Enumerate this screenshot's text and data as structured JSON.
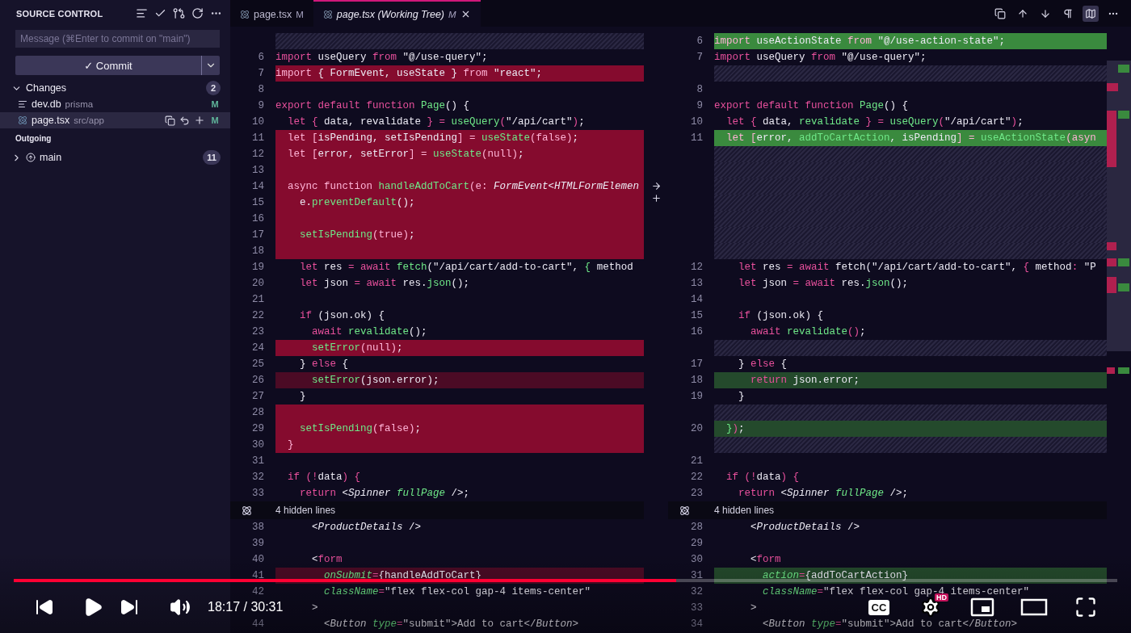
{
  "sidebar": {
    "title": "SOURCE CONTROL",
    "message": {
      "placeholder": "Message (⌘Enter to commit on \"main\")"
    },
    "commit": {
      "label": "✓ Commit"
    },
    "changes": {
      "label": "Changes",
      "count": "2",
      "expanded": true,
      "files": [
        {
          "name": "dev.db",
          "path": "prisma",
          "status": "M",
          "selected": false,
          "kind": "text"
        },
        {
          "name": "page.tsx",
          "path": "src/app",
          "status": "M",
          "selected": true,
          "kind": "react"
        }
      ]
    },
    "outgoing": {
      "label": "Outgoing",
      "branches": [
        {
          "name": "main",
          "count": "11",
          "expanded": false
        }
      ]
    }
  },
  "tabs": [
    {
      "name": "page.tsx",
      "status": "M",
      "italic": false,
      "selected": false
    },
    {
      "name": "page.tsx (Working Tree)",
      "status": "M",
      "italic": true,
      "selected": true
    }
  ],
  "diff": {
    "original": [
      {
        "kind": "filler"
      },
      {
        "kind": "line",
        "num": "6",
        "code": [
          {
            "text": "import ",
            "kind": "keyword"
          },
          {
            "text": "useQuery ",
            "kind": "plain"
          },
          {
            "text": "from ",
            "kind": "keyword"
          },
          {
            "text": "\"@/use-query\";",
            "kind": "plain"
          }
        ]
      },
      {
        "kind": "removed",
        "num": "7",
        "code": [
          {
            "text": "import ",
            "kind": "keyword"
          },
          {
            "text": "{ FormEvent, useState } ",
            "kind": "plain"
          },
          {
            "text": "from ",
            "kind": "keyword"
          },
          {
            "text": "\"react\";",
            "kind": "plain"
          }
        ]
      },
      {
        "kind": "line",
        "num": "8"
      },
      {
        "kind": "line",
        "num": "9",
        "code": [
          {
            "text": "export default function ",
            "kind": "keyword"
          },
          {
            "text": "Page",
            "kind": "function"
          },
          {
            "text": "() {",
            "kind": "plain"
          }
        ]
      },
      {
        "kind": "line",
        "num": "10",
        "code": [
          {
            "text": "  let { ",
            "kind": "keyword"
          },
          {
            "text": "data, revalidate ",
            "kind": "plain"
          },
          {
            "text": "} = ",
            "kind": "keyword"
          },
          {
            "text": "useQuery",
            "kind": "function"
          },
          {
            "text": "(",
            "kind": "keyword"
          },
          {
            "text": "\"/api/cart\"",
            "kind": "plain"
          },
          {
            "text": ")",
            "kind": "keyword"
          },
          {
            "text": ";",
            "kind": "plain"
          }
        ]
      },
      {
        "kind": "removed",
        "num": "11",
        "code": [
          {
            "text": "  let [",
            "kind": "keyword"
          },
          {
            "text": "isPending, setIsPending",
            "kind": "plain"
          },
          {
            "text": "] = ",
            "kind": "keyword"
          },
          {
            "text": "useState",
            "kind": "function"
          },
          {
            "text": "(false)",
            "kind": "keyword"
          },
          {
            "text": ";",
            "kind": "plain"
          }
        ]
      },
      {
        "kind": "removed",
        "num": "12",
        "code": [
          {
            "text": "  let [",
            "kind": "keyword"
          },
          {
            "text": "error, setError",
            "kind": "plain"
          },
          {
            "text": "] = ",
            "kind": "keyword"
          },
          {
            "text": "useState",
            "kind": "function"
          },
          {
            "text": "(null)",
            "kind": "keyword"
          },
          {
            "text": ";",
            "kind": "plain"
          }
        ]
      },
      {
        "kind": "removed",
        "num": "13"
      },
      {
        "kind": "removed",
        "num": "14",
        "code": [
          {
            "text": "  async function ",
            "kind": "keyword"
          },
          {
            "text": "handleAddToCart",
            "kind": "function"
          },
          {
            "text": "(e: ",
            "kind": "keyword"
          },
          {
            "text": "FormEvent<HTMLFormElemen",
            "kind": "type"
          }
        ]
      },
      {
        "kind": "removed",
        "num": "15",
        "code": [
          {
            "text": "    e.",
            "kind": "plain"
          },
          {
            "text": "preventDefault",
            "kind": "function"
          },
          {
            "text": "();",
            "kind": "plain"
          }
        ]
      },
      {
        "kind": "removed",
        "num": "16"
      },
      {
        "kind": "removed",
        "num": "17",
        "code": [
          {
            "text": "    setIsPending",
            "kind": "function"
          },
          {
            "text": "(true)",
            "kind": "keyword"
          },
          {
            "text": ";",
            "kind": "plain"
          }
        ]
      },
      {
        "kind": "removed",
        "num": "18"
      },
      {
        "kind": "line",
        "num": "19",
        "code": [
          {
            "text": "    let ",
            "kind": "keyword"
          },
          {
            "text": "res ",
            "kind": "plain"
          },
          {
            "text": "= await ",
            "kind": "keyword"
          },
          {
            "text": "fetch",
            "kind": "function"
          },
          {
            "text": "(\"/api/cart/add-to-cart\", ",
            "kind": "plain"
          },
          {
            "text": "{ ",
            "kind": "function"
          },
          {
            "text": "method",
            "kind": "plain"
          }
        ]
      },
      {
        "kind": "line",
        "num": "20",
        "code": [
          {
            "text": "    let ",
            "kind": "keyword"
          },
          {
            "text": "json ",
            "kind": "plain"
          },
          {
            "text": "= await ",
            "kind": "keyword"
          },
          {
            "text": "res.",
            "kind": "plain"
          },
          {
            "text": "json",
            "kind": "function"
          },
          {
            "text": "();",
            "kind": "plain"
          }
        ]
      },
      {
        "kind": "line",
        "num": "21"
      },
      {
        "kind": "line",
        "num": "22",
        "code": [
          {
            "text": "    if ",
            "kind": "keyword"
          },
          {
            "text": "(json.ok) {",
            "kind": "plain"
          }
        ]
      },
      {
        "kind": "line",
        "num": "23",
        "code": [
          {
            "text": "      await ",
            "kind": "keyword"
          },
          {
            "text": "revalidate",
            "kind": "function"
          },
          {
            "text": "();",
            "kind": "plain"
          }
        ]
      },
      {
        "kind": "removed",
        "num": "24",
        "code": [
          {
            "text": "      setError",
            "kind": "function"
          },
          {
            "text": "(null)",
            "kind": "keyword"
          },
          {
            "text": ";",
            "kind": "plain"
          }
        ]
      },
      {
        "kind": "line",
        "num": "25",
        "code": [
          {
            "text": "    } ",
            "kind": "plain"
          },
          {
            "text": "else ",
            "kind": "keyword"
          },
          {
            "text": "{",
            "kind": "plain"
          }
        ]
      },
      {
        "kind": "removed-soft",
        "num": "26",
        "code": [
          {
            "text": "      setError",
            "kind": "function"
          },
          {
            "text": "(json.error);",
            "kind": "plain"
          }
        ]
      },
      {
        "kind": "line",
        "num": "27",
        "code": [
          {
            "text": "    }",
            "kind": "plain"
          }
        ]
      },
      {
        "kind": "removed",
        "num": "28"
      },
      {
        "kind": "removed",
        "num": "29",
        "code": [
          {
            "text": "    setIsPending",
            "kind": "function"
          },
          {
            "text": "(false)",
            "kind": "keyword"
          },
          {
            "text": ";",
            "kind": "plain"
          }
        ]
      },
      {
        "kind": "removed",
        "num": "30",
        "code": [
          {
            "text": "  }",
            "kind": "keyword"
          }
        ]
      },
      {
        "kind": "line",
        "num": "31"
      },
      {
        "kind": "line",
        "num": "32",
        "code": [
          {
            "text": "  if (!",
            "kind": "keyword"
          },
          {
            "text": "data",
            "kind": "plain"
          },
          {
            "text": ") {",
            "kind": "keyword"
          }
        ]
      },
      {
        "kind": "line",
        "num": "33",
        "code": [
          {
            "text": "    return ",
            "kind": "keyword"
          },
          {
            "text": "<",
            "kind": "plain"
          },
          {
            "text": "Spinner ",
            "kind": "type"
          },
          {
            "text": "fullPage ",
            "kind": "attribute"
          },
          {
            "text": "/>;",
            "kind": "plain"
          }
        ]
      },
      {
        "kind": "hidden",
        "text": "4 hidden lines"
      },
      {
        "kind": "line",
        "num": "38",
        "code": [
          {
            "text": "      <",
            "kind": "plain"
          },
          {
            "text": "ProductDetails ",
            "kind": "type"
          },
          {
            "text": "/>",
            "kind": "plain"
          }
        ]
      },
      {
        "kind": "line",
        "num": "39"
      },
      {
        "kind": "line",
        "num": "40",
        "code": [
          {
            "text": "      <",
            "kind": "plain"
          },
          {
            "text": "form",
            "kind": "keyword"
          }
        ]
      },
      {
        "kind": "removed-soft",
        "num": "41",
        "code": [
          {
            "text": "        onSubmit",
            "kind": "attribute"
          },
          {
            "text": "=",
            "kind": "keyword"
          },
          {
            "text": "{handleAddToCart}",
            "kind": "plain"
          }
        ]
      },
      {
        "kind": "line",
        "num": "42",
        "code": [
          {
            "text": "        className",
            "kind": "attribute"
          },
          {
            "text": "=",
            "kind": "keyword"
          },
          {
            "text": "\"flex flex-col gap-4 items-center\"",
            "kind": "plain"
          }
        ]
      },
      {
        "kind": "line",
        "code": [
          {
            "text": "      >",
            "kind": "plain"
          }
        ]
      },
      {
        "kind": "line",
        "num": "44",
        "code": [
          {
            "text": "        <",
            "kind": "plain"
          },
          {
            "text": "Button ",
            "kind": "type"
          },
          {
            "text": "type",
            "kind": "attribute"
          },
          {
            "text": "=",
            "kind": "keyword"
          },
          {
            "text": "\"submit\">Add to cart</",
            "kind": "plain"
          },
          {
            "text": "Button",
            "kind": "type"
          },
          {
            "text": ">",
            "kind": "plain"
          }
        ]
      }
    ],
    "modified": [
      {
        "kind": "added",
        "num": "6",
        "code": [
          {
            "text": "import ",
            "kind": "keyword"
          },
          {
            "text": "useActionState ",
            "kind": "plain"
          },
          {
            "text": "from ",
            "kind": "keyword"
          },
          {
            "text": "\"@/use-action-state\";",
            "kind": "plain"
          }
        ]
      },
      {
        "kind": "line",
        "num": "7",
        "code": [
          {
            "text": "import ",
            "kind": "keyword"
          },
          {
            "text": "useQuery ",
            "kind": "plain"
          },
          {
            "text": "from ",
            "kind": "keyword"
          },
          {
            "text": "\"@/use-query\";",
            "kind": "plain"
          }
        ]
      },
      {
        "kind": "filler"
      },
      {
        "kind": "line",
        "num": "8"
      },
      {
        "kind": "line",
        "num": "9",
        "code": [
          {
            "text": "export default function ",
            "kind": "keyword"
          },
          {
            "text": "Page",
            "kind": "function"
          },
          {
            "text": "() {",
            "kind": "plain"
          }
        ]
      },
      {
        "kind": "line",
        "num": "10",
        "code": [
          {
            "text": "  let { ",
            "kind": "keyword"
          },
          {
            "text": "data, ",
            "kind": "plain"
          },
          {
            "text": "revalidate ",
            "kind": "function"
          },
          {
            "text": "} = ",
            "kind": "keyword"
          },
          {
            "text": "useQuery",
            "kind": "function"
          },
          {
            "text": "(",
            "kind": "keyword"
          },
          {
            "text": "\"/api/cart\"",
            "kind": "plain"
          },
          {
            "text": ")",
            "kind": "keyword"
          },
          {
            "text": ";",
            "kind": "plain"
          }
        ]
      },
      {
        "kind": "added",
        "num": "11",
        "code": [
          {
            "text": "  let [",
            "kind": "keyword"
          },
          {
            "text": "error, ",
            "kind": "plain"
          },
          {
            "text": "addToCartAction",
            "kind": "function"
          },
          {
            "text": ", isPending",
            "kind": "plain"
          },
          {
            "text": "] = ",
            "kind": "keyword"
          },
          {
            "text": "useActionState",
            "kind": "function"
          },
          {
            "text": "(asyn",
            "kind": "keyword"
          }
        ]
      },
      {
        "kind": "filler"
      },
      {
        "kind": "filler"
      },
      {
        "kind": "filler"
      },
      {
        "kind": "filler"
      },
      {
        "kind": "filler"
      },
      {
        "kind": "filler"
      },
      {
        "kind": "filler"
      },
      {
        "kind": "line",
        "num": "12",
        "code": [
          {
            "text": "    let ",
            "kind": "keyword"
          },
          {
            "text": "res ",
            "kind": "plain"
          },
          {
            "text": "= await ",
            "kind": "keyword"
          },
          {
            "text": "fetch(\"/api/cart/add-to-cart\", ",
            "kind": "plain"
          },
          {
            "text": "{ ",
            "kind": "keyword"
          },
          {
            "text": "method",
            "kind": "plain"
          },
          {
            "text": ": ",
            "kind": "keyword"
          },
          {
            "text": "\"P",
            "kind": "plain"
          }
        ]
      },
      {
        "kind": "line",
        "num": "13",
        "code": [
          {
            "text": "    let ",
            "kind": "keyword"
          },
          {
            "text": "json ",
            "kind": "plain"
          },
          {
            "text": "= await ",
            "kind": "keyword"
          },
          {
            "text": "res.",
            "kind": "plain"
          },
          {
            "text": "json",
            "kind": "function"
          },
          {
            "text": "();",
            "kind": "plain"
          }
        ]
      },
      {
        "kind": "line",
        "num": "14"
      },
      {
        "kind": "line",
        "num": "15",
        "code": [
          {
            "text": "    if ",
            "kind": "keyword"
          },
          {
            "text": "(json.ok) {",
            "kind": "plain"
          }
        ]
      },
      {
        "kind": "line",
        "num": "16",
        "code": [
          {
            "text": "      await ",
            "kind": "keyword"
          },
          {
            "text": "revalidate",
            "kind": "function"
          },
          {
            "text": "()",
            "kind": "keyword"
          },
          {
            "text": ";",
            "kind": "plain"
          }
        ]
      },
      {
        "kind": "filler"
      },
      {
        "kind": "line",
        "num": "17",
        "code": [
          {
            "text": "    } ",
            "kind": "plain"
          },
          {
            "text": "else ",
            "kind": "keyword"
          },
          {
            "text": "{",
            "kind": "plain"
          }
        ]
      },
      {
        "kind": "added-soft",
        "num": "18",
        "code": [
          {
            "text": "      return ",
            "kind": "keyword"
          },
          {
            "text": "json.error;",
            "kind": "plain"
          }
        ]
      },
      {
        "kind": "line",
        "num": "19",
        "code": [
          {
            "text": "    }",
            "kind": "plain"
          }
        ]
      },
      {
        "kind": "filler"
      },
      {
        "kind": "added-soft",
        "num": "20",
        "code": [
          {
            "text": "  }",
            "kind": "function"
          },
          {
            "text": ")",
            "kind": "keyword"
          },
          {
            "text": ";",
            "kind": "plain"
          }
        ]
      },
      {
        "kind": "filler"
      },
      {
        "kind": "line",
        "num": "21"
      },
      {
        "kind": "line",
        "num": "22",
        "code": [
          {
            "text": "  if (!",
            "kind": "keyword"
          },
          {
            "text": "data",
            "kind": "plain"
          },
          {
            "text": ") {",
            "kind": "keyword"
          }
        ]
      },
      {
        "kind": "line",
        "num": "23",
        "code": [
          {
            "text": "    return ",
            "kind": "keyword"
          },
          {
            "text": "<",
            "kind": "plain"
          },
          {
            "text": "Spinner ",
            "kind": "type"
          },
          {
            "text": "fullPage ",
            "kind": "attribute"
          },
          {
            "text": "/>;",
            "kind": "plain"
          }
        ]
      },
      {
        "kind": "hidden",
        "text": "4 hidden lines"
      },
      {
        "kind": "line",
        "num": "28",
        "code": [
          {
            "text": "      <",
            "kind": "plain"
          },
          {
            "text": "ProductDetails ",
            "kind": "type"
          },
          {
            "text": "/>",
            "kind": "plain"
          }
        ]
      },
      {
        "kind": "line",
        "num": "29"
      },
      {
        "kind": "line",
        "num": "30",
        "code": [
          {
            "text": "      <",
            "kind": "plain"
          },
          {
            "text": "form",
            "kind": "keyword"
          }
        ]
      },
      {
        "kind": "added-soft",
        "num": "31",
        "code": [
          {
            "text": "        action",
            "kind": "attribute"
          },
          {
            "text": "=",
            "kind": "keyword"
          },
          {
            "text": "{addToCartAction}",
            "kind": "plain"
          }
        ]
      },
      {
        "kind": "line",
        "num": "32",
        "code": [
          {
            "text": "        className",
            "kind": "attribute"
          },
          {
            "text": "=",
            "kind": "keyword"
          },
          {
            "text": "\"flex flex-col gap-4 items-center\"",
            "kind": "plain"
          }
        ]
      },
      {
        "kind": "line",
        "num": "33",
        "code": [
          {
            "text": "      >",
            "kind": "plain"
          }
        ]
      },
      {
        "kind": "line",
        "num": "34",
        "code": [
          {
            "text": "        <",
            "kind": "plain"
          },
          {
            "text": "Button ",
            "kind": "type"
          },
          {
            "text": "type",
            "kind": "attribute"
          },
          {
            "text": "=",
            "kind": "keyword"
          },
          {
            "text": "\"submit\">Add to cart</",
            "kind": "plain"
          },
          {
            "text": "Button",
            "kind": "type"
          },
          {
            "text": ">",
            "kind": "plain"
          }
        ]
      }
    ]
  },
  "player": {
    "time": "18:17 / 30:31",
    "level": 0.6,
    "hd": "HD",
    "captions": "CC"
  }
}
